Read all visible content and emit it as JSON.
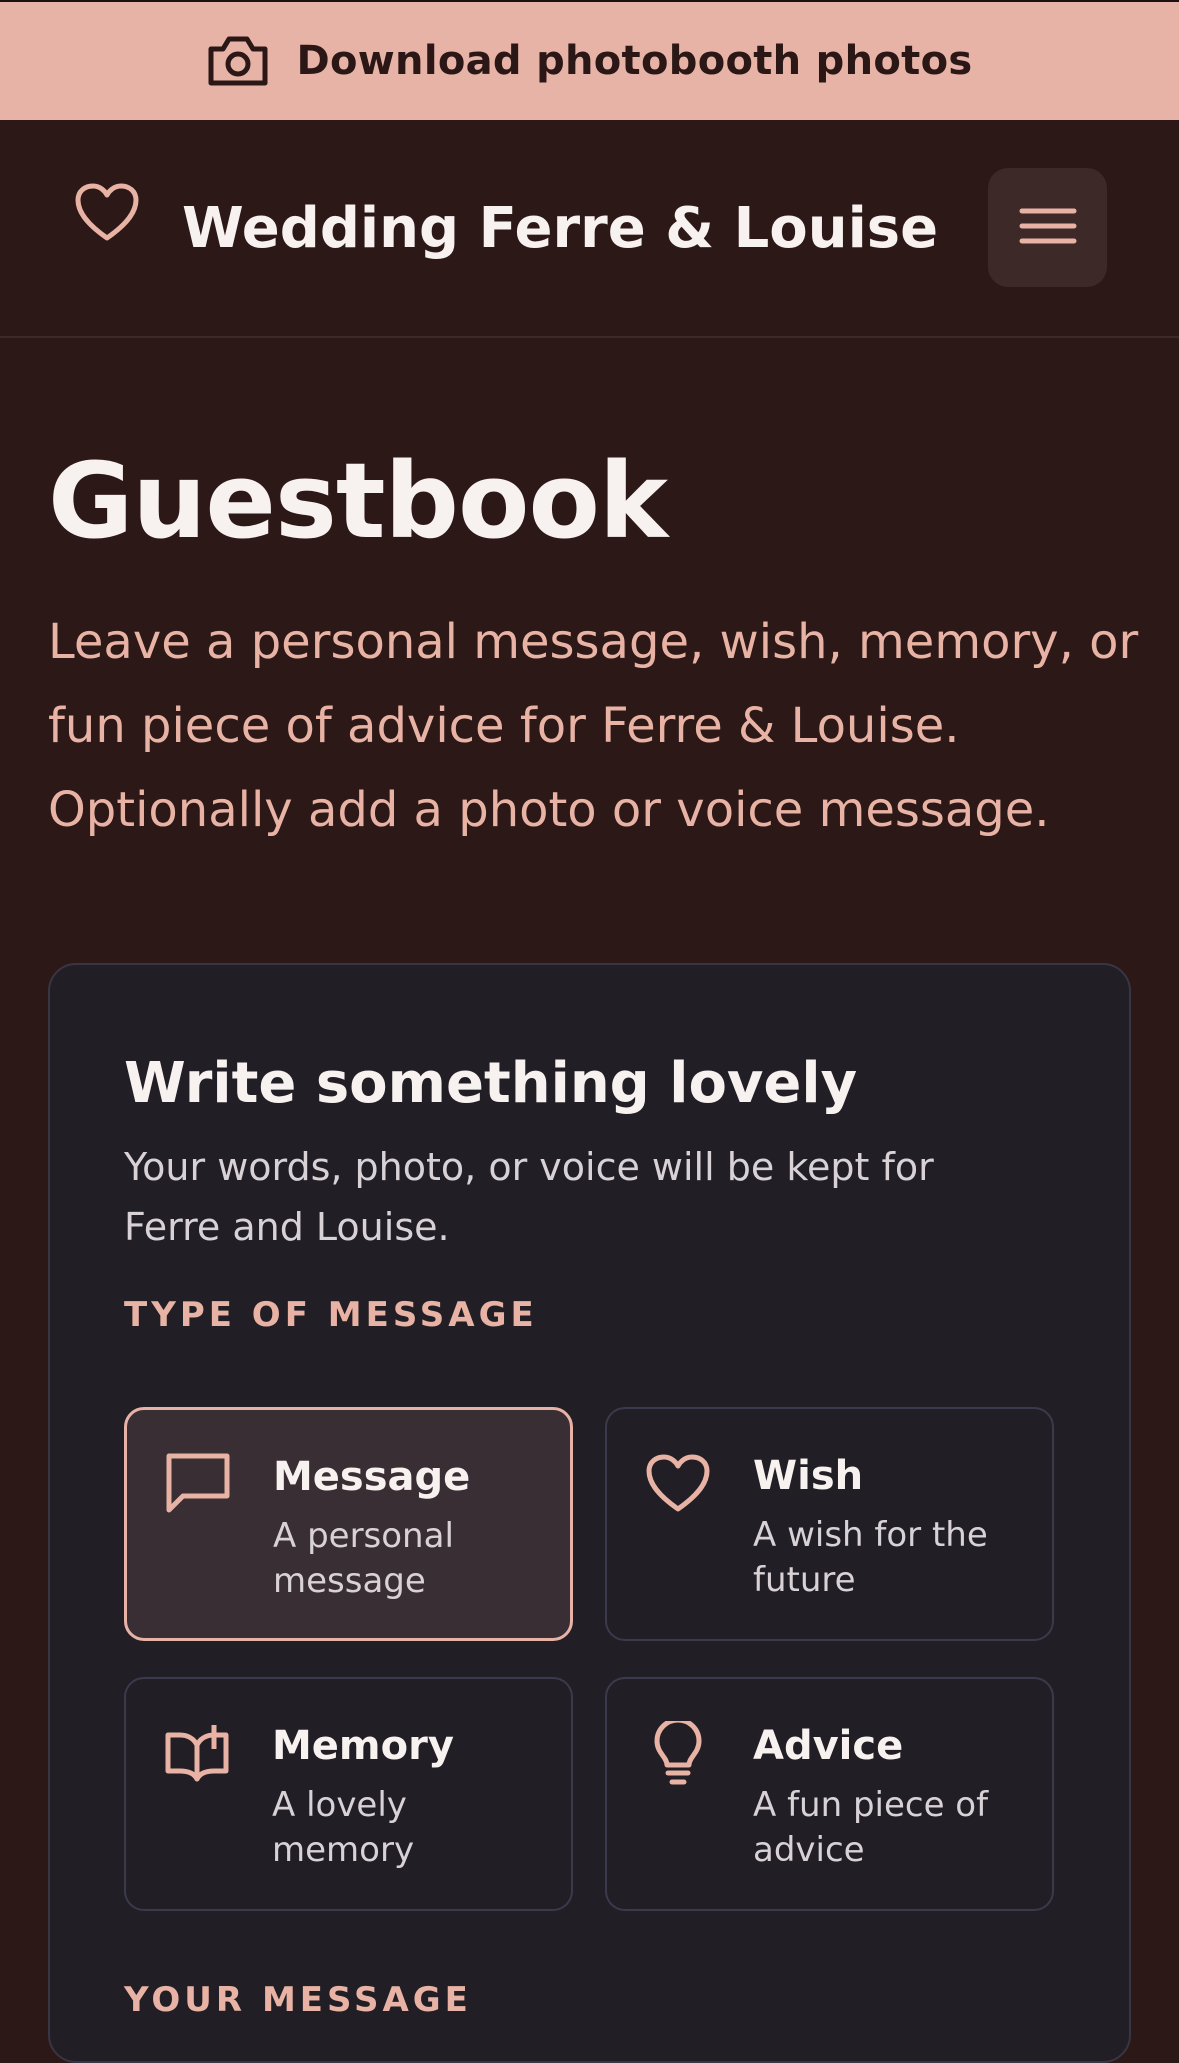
{
  "banner": {
    "label": "Download photobooth photos",
    "icon": "camera-icon"
  },
  "header": {
    "title": "Wedding Ferre & Louise",
    "logo_icon": "heart-icon",
    "menu_icon": "hamburger-menu-icon"
  },
  "page": {
    "title": "Guestbook",
    "subtitle": "Leave a personal message, wish, memory, or fun piece of advice for Ferre & Louise. Optionally add a photo or voice message."
  },
  "form": {
    "title": "Write something lovely",
    "description": "Your words, photo, or voice will be kept for Ferre and Louise.",
    "type_label": "TYPE OF MESSAGE",
    "types": [
      {
        "title": "Message",
        "desc": "A personal message",
        "icon": "chat-bubble-icon",
        "selected": true
      },
      {
        "title": "Wish",
        "desc": "A wish for the future",
        "icon": "heart-icon",
        "selected": false
      },
      {
        "title": "Memory",
        "desc": "A lovely memory",
        "icon": "open-book-icon",
        "selected": false
      },
      {
        "title": "Advice",
        "desc": "A fun piece of advice",
        "icon": "lightbulb-icon",
        "selected": false
      }
    ],
    "message_label": "YOUR MESSAGE"
  },
  "colors": {
    "background": "#2b1817",
    "banner": "#e6b3a6",
    "accent": "#e8b3a4",
    "card": "#211e25",
    "selected": "#3a2e35"
  }
}
